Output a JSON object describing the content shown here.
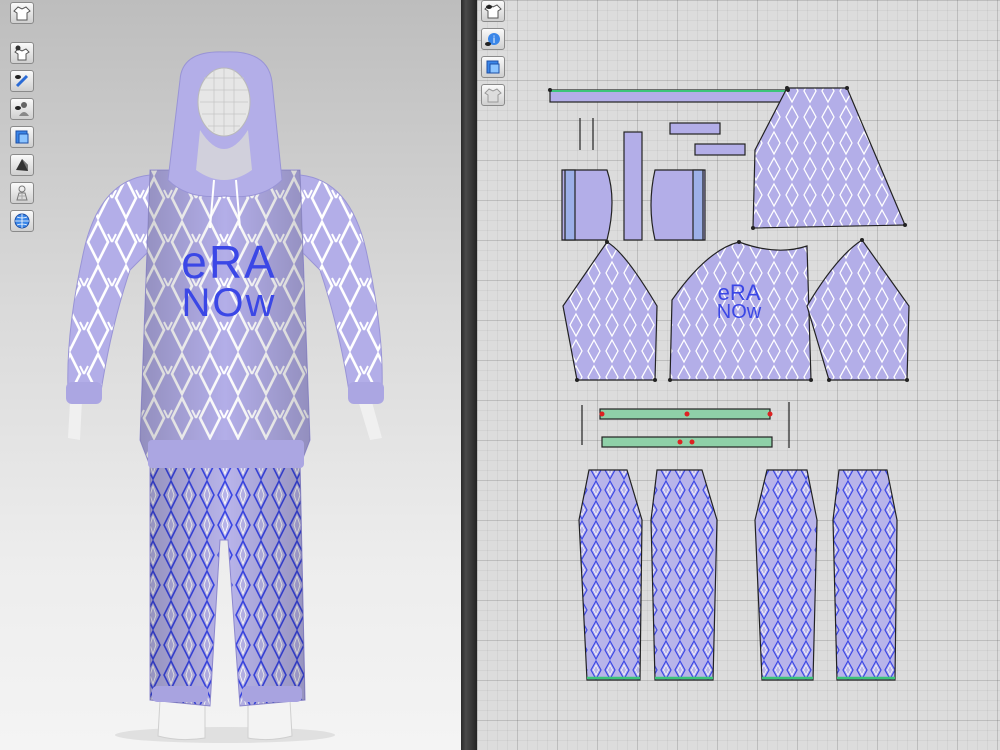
{
  "app": {
    "panes": [
      "3d-avatar-view",
      "2d-pattern-view"
    ]
  },
  "toolbar_3d": [
    {
      "name": "show-garment-icon"
    },
    {
      "name": "show-avatar-icon"
    },
    {
      "name": "texture-eye-icon"
    },
    {
      "name": "avatar-visibility-icon"
    },
    {
      "name": "fabric-render-icon"
    },
    {
      "name": "shaded-view-icon"
    },
    {
      "name": "mesh-view-icon"
    },
    {
      "name": "globe-environment-icon"
    }
  ],
  "toolbar_2d": [
    {
      "name": "show-pattern-icon"
    },
    {
      "name": "info-icon"
    },
    {
      "name": "fabric-texture-icon"
    },
    {
      "name": "garment-outline-icon"
    }
  ],
  "garment": {
    "print_text": "era now",
    "print_line1": "eRA",
    "print_line2": "NOw",
    "colors": {
      "fabric": "#b3aee8",
      "fabric_dark": "#9a94d8",
      "pattern_line": "#ffffff",
      "pants_line": "#3b47e6",
      "seam_green": "#3cc47a",
      "point": "#222222"
    }
  }
}
